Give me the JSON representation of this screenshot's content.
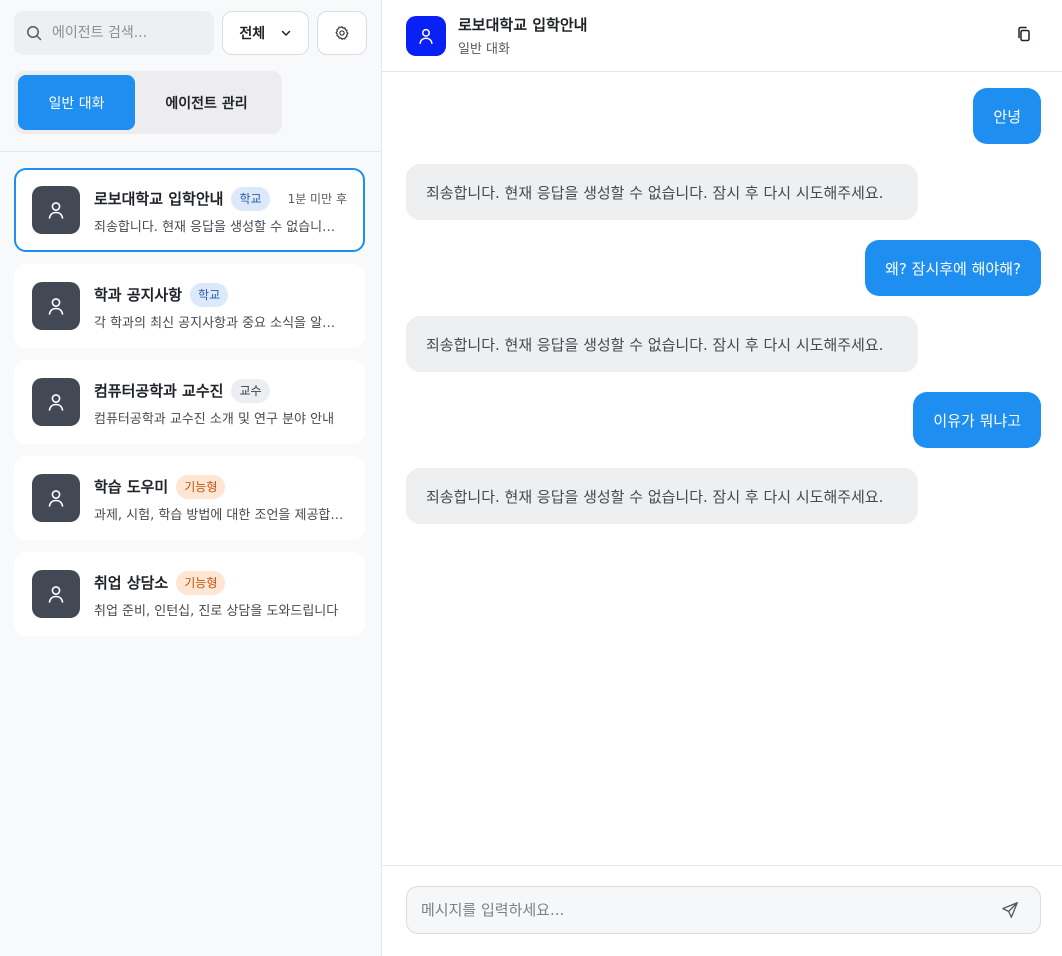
{
  "sidebar": {
    "search": {
      "placeholder": "에이전트 검색...",
      "icon": "search-icon"
    },
    "filter": {
      "selected": "전체",
      "icon": "chevron-down-icon"
    },
    "settings": {
      "icon": "gear-icon"
    },
    "mode_tabs": [
      {
        "label": "일반 대화",
        "active": true
      },
      {
        "label": "에이전트 관리",
        "active": false
      }
    ],
    "agents": [
      {
        "name": "로보대학교 입학안내",
        "badge": "학교",
        "badge_type": "school",
        "time": "1분 미만 후",
        "desc": "죄송합니다. 현재 응답을 생성할 수 없습니다. 잠시 후 다시 시도해주세요.",
        "selected": true
      },
      {
        "name": "학과 공지사항",
        "badge": "학교",
        "badge_type": "school",
        "time": "",
        "desc": "각 학과의 최신 공지사항과 중요 소식을 알려드립니다",
        "selected": false
      },
      {
        "name": "컴퓨터공학과 교수진",
        "badge": "교수",
        "badge_type": "prof",
        "time": "",
        "desc": "컴퓨터공학과 교수진 소개 및 연구 분야 안내",
        "selected": false
      },
      {
        "name": "학습 도우미",
        "badge": "기능형",
        "badge_type": "func",
        "time": "",
        "desc": "과제, 시험, 학습 방법에 대한 조언을 제공합니다",
        "selected": false
      },
      {
        "name": "취업 상담소",
        "badge": "기능형",
        "badge_type": "func",
        "time": "",
        "desc": "취업 준비, 인턴십, 진로 상담을 도와드립니다",
        "selected": false
      }
    ]
  },
  "header": {
    "title": "로보대학교 입학안내",
    "subtitle": "일반 대화",
    "copy_icon": "copy-icon",
    "avatar_icon": "user-icon"
  },
  "messages": [
    {
      "role": "user",
      "text": "안녕"
    },
    {
      "role": "bot",
      "text": "죄송합니다. 현재 응답을 생성할 수 없습니다. 잠시 후 다시 시도해주세요."
    },
    {
      "role": "user",
      "text": "왜? 잠시후에 해야해?"
    },
    {
      "role": "bot",
      "text": "죄송합니다. 현재 응답을 생성할 수 없습니다. 잠시 후 다시 시도해주세요."
    },
    {
      "role": "user",
      "text": "이유가 뭐냐고"
    },
    {
      "role": "bot",
      "text": "죄송합니다. 현재 응답을 생성할 수 없습니다. 잠시 후 다시 시도해주세요."
    }
  ],
  "composer": {
    "placeholder": "메시지를 입력하세요...",
    "send_icon": "send-icon"
  },
  "colors": {
    "accent": "#1f8ef1",
    "header_avatar": "#0a21f5",
    "agent_avatar": "#424955"
  }
}
